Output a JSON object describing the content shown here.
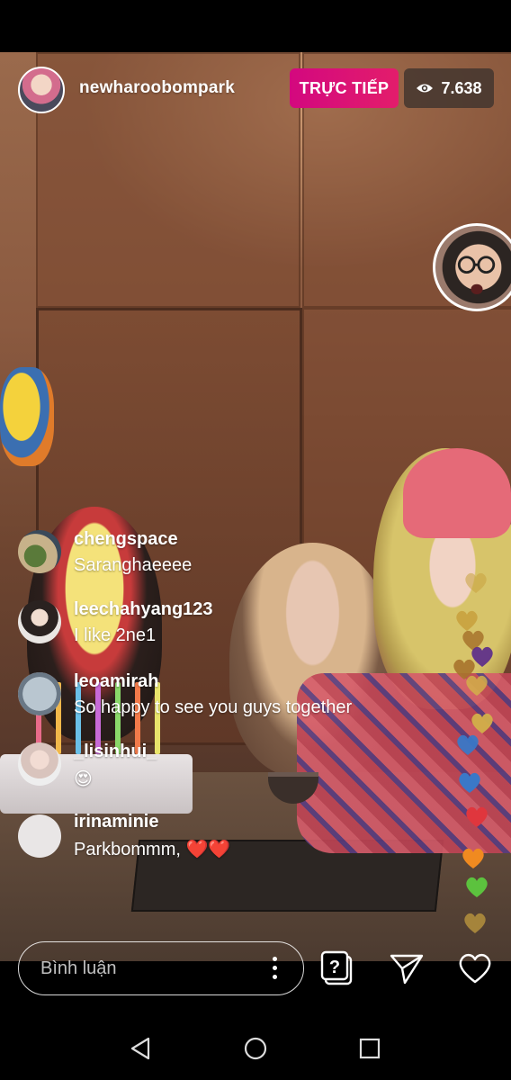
{
  "header": {
    "host_username": "newharoobompark",
    "live_label": "TRỰC TIẾP",
    "viewer_count": "7.638",
    "viewer_icon": "eye-icon"
  },
  "comments": [
    {
      "username": "chengspace",
      "text": "Saranghaeeee"
    },
    {
      "username": "leechahyang123",
      "text": "I like 2ne1"
    },
    {
      "username": "leoamirah",
      "text": "So happy to see you guys together"
    },
    {
      "username": "_lisinhui_",
      "text": "😍"
    },
    {
      "username": "irinaminie",
      "text": "Parkbommm, ❤️❤️"
    }
  ],
  "bottom_bar": {
    "comment_placeholder": "Bình luận",
    "icons": [
      "more-options-icon",
      "question-sticker-icon",
      "send-icon",
      "like-heart-icon"
    ]
  },
  "nav_bar": {
    "icons": [
      "back-icon",
      "home-icon",
      "recent-apps-icon"
    ]
  },
  "colors": {
    "live_badge": "#d3087f",
    "viewer_badge_bg": "#3c322d",
    "heart_colors": [
      "#c9a23f",
      "#a8742c",
      "#5a2a8c",
      "#d3b04a",
      "#3a78c8",
      "#e0363d",
      "#f08a20",
      "#5cc23e"
    ]
  }
}
